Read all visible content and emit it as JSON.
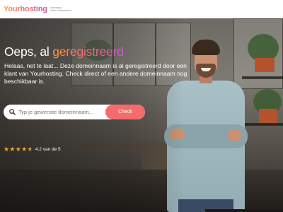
{
  "header": {
    "logo_text": "Yourhosting",
    "tagline_line1": "onbezorgd",
    "tagline_line2": "online ondernemen"
  },
  "hero": {
    "title_plain": "Oeps, al ",
    "title_accent": "geregistreerd",
    "subtitle": "Helaas, net te laat... Deze domeinnaam is al geregistreerd door een klant van Yourhosting. Check direct of een andere domeinnaam nog beschikbaar is."
  },
  "search": {
    "placeholder": "Typ je gewenste domeinnaam...",
    "value": "",
    "button_label": "Check"
  },
  "rating": {
    "score": 4.2,
    "text": "4.2 van de 5",
    "stars": [
      "★",
      "★",
      "★",
      "★",
      "★"
    ]
  },
  "colors": {
    "accent_start": "#ff9a3c",
    "accent_mid": "#f46b6b",
    "accent_end": "#c95bd0",
    "button": "#f46b6b",
    "star": "#f5a623"
  },
  "icons": {
    "search": "search-icon",
    "star": "star-icon"
  }
}
